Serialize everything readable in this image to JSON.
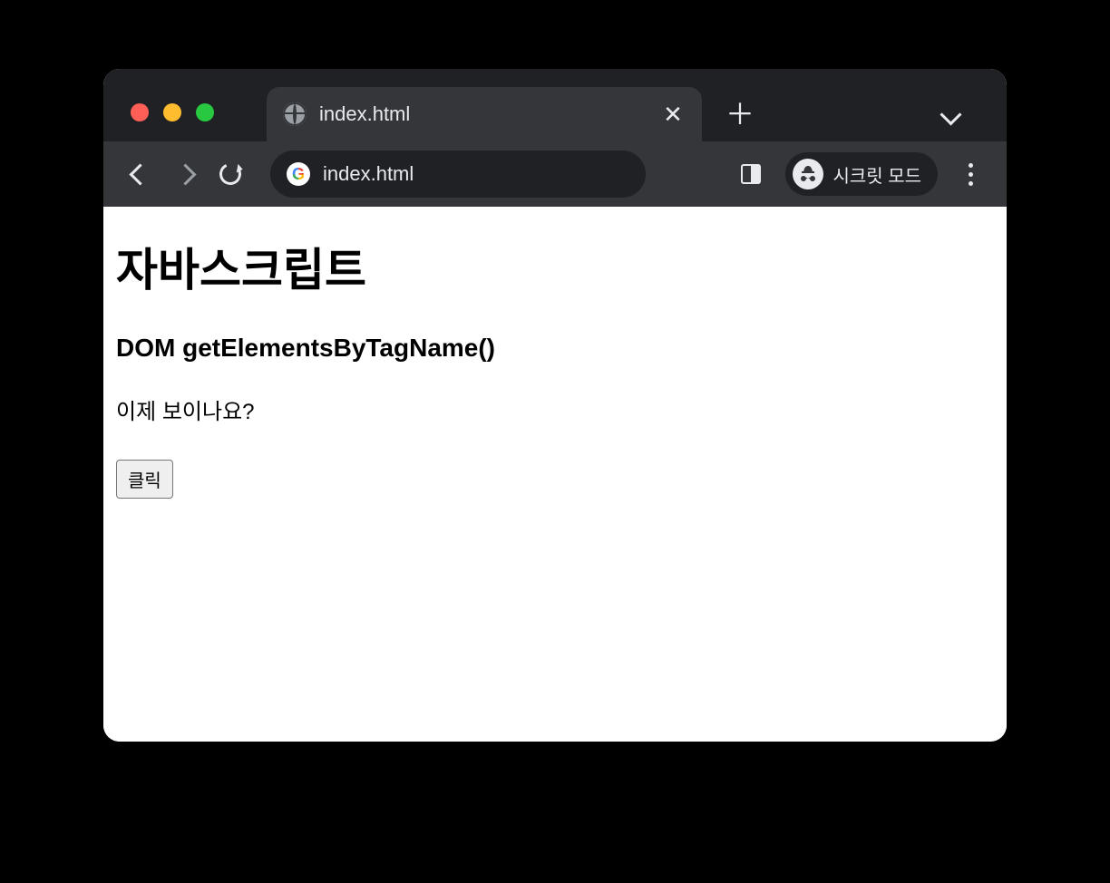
{
  "browser": {
    "tab_title": "index.html",
    "url": "index.html",
    "incognito_label": "시크릿 모드"
  },
  "page": {
    "heading1": "자바스크립트",
    "heading2": "DOM getElementsByTagName()",
    "paragraph": "이제 보이나요?",
    "button_label": "클릭"
  }
}
